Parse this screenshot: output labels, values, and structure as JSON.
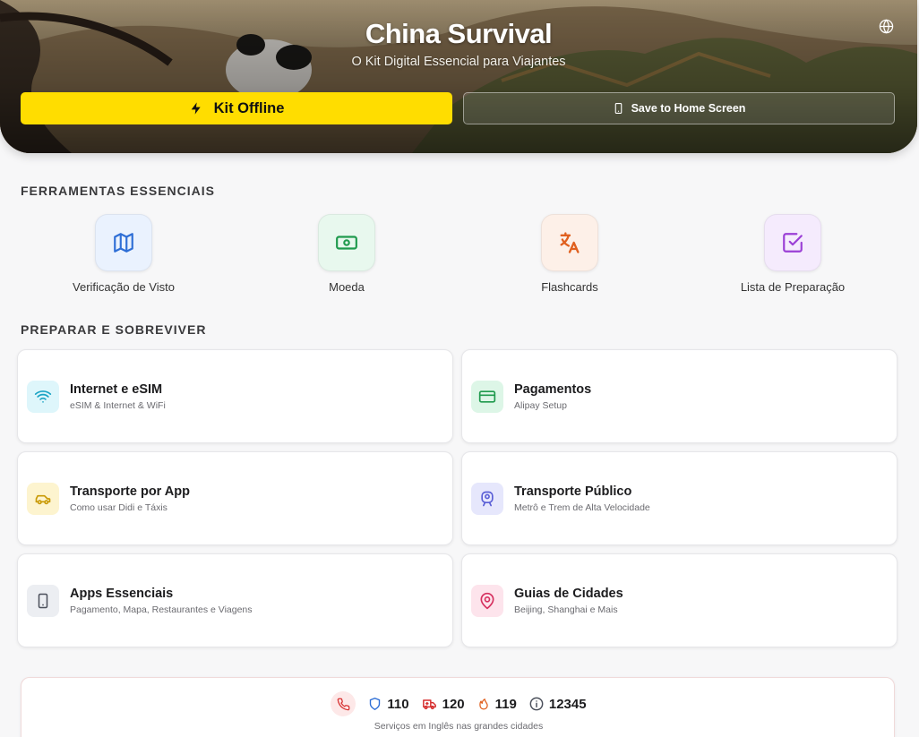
{
  "hero": {
    "title": "China Survival",
    "subtitle": "O Kit Digital Essencial para Viajantes",
    "offline_button": "Kit Offline",
    "save_button": "Save to Home Screen",
    "language_icon": "globe-icon"
  },
  "tools": {
    "title": "FERRAMENTAS ESSENCIAIS",
    "items": [
      {
        "label": "Verificação de Visto",
        "icon": "map-icon",
        "color": "#2f6fd6",
        "bg": "#eaf2fe"
      },
      {
        "label": "Moeda",
        "icon": "banknote-icon",
        "color": "#1f9a4d",
        "bg": "#e8f8ee"
      },
      {
        "label": "Flashcards",
        "icon": "translate-icon",
        "color": "#e0601f",
        "bg": "#fdf0e8"
      },
      {
        "label": "Lista de Preparação",
        "icon": "checkbox-icon",
        "color": "#9b3fd6",
        "bg": "#f5ebfd"
      }
    ]
  },
  "guides": {
    "title": "PREPARAR E SOBREVIVER",
    "items": [
      {
        "title": "Internet e eSIM",
        "subtitle": "eSIM & Internet & WiFi",
        "icon": "wifi-icon",
        "color": "#1aa3c4",
        "bg": "#def6fb"
      },
      {
        "title": "Pagamentos",
        "subtitle": "Alipay Setup",
        "icon": "credit-card-icon",
        "color": "#1f9a4d",
        "bg": "#ddf6e7"
      },
      {
        "title": "Transporte por App",
        "subtitle": "Como usar Didi e Táxis",
        "icon": "car-icon",
        "color": "#c99a06",
        "bg": "#fdf4cf"
      },
      {
        "title": "Transporte Público",
        "subtitle": "Metrô e Trem de Alta Velocidade",
        "icon": "train-icon",
        "color": "#5a5fd6",
        "bg": "#e6e7fc"
      },
      {
        "title": "Apps Essenciais",
        "subtitle": "Pagamento, Mapa, Restaurantes e Viagens",
        "icon": "smartphone-icon",
        "color": "#4a4f5a",
        "bg": "#eceef2"
      },
      {
        "title": "Guias de Cidades",
        "subtitle": "Beijing, Shanghai e Mais",
        "icon": "map-pin-icon",
        "color": "#d6305f",
        "bg": "#fde4ec"
      }
    ]
  },
  "emergency": {
    "phone_icon": "phone-icon",
    "numbers": [
      {
        "icon": "shield-icon",
        "number": "110",
        "color": "#2f6fd6"
      },
      {
        "icon": "ambulance-icon",
        "number": "120",
        "color": "#d62f2f"
      },
      {
        "icon": "flame-icon",
        "number": "119",
        "color": "#e0601f"
      },
      {
        "icon": "info-icon",
        "number": "12345",
        "color": "#4a4f5a"
      }
    ],
    "note": "Serviços em Inglês nas grandes cidades"
  }
}
